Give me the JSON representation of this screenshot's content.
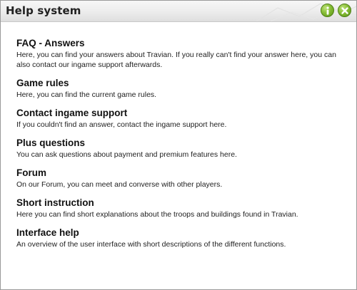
{
  "window": {
    "title": "Help system",
    "info_icon": "info-icon",
    "close_icon": "close-icon"
  },
  "entries": [
    {
      "title": "FAQ - Answers",
      "description": "Here, you can find your answers about Travian. If you really can't find your answer here, you can also contact our ingame support afterwards."
    },
    {
      "title": "Game rules",
      "description": "Here, you can find the current game rules."
    },
    {
      "title": "Contact ingame support",
      "description": "If you couldn't find an answer, contact the ingame support here."
    },
    {
      "title": "Plus questions",
      "description": "You can ask questions about payment and premium features here."
    },
    {
      "title": "Forum",
      "description": "On our Forum, you can meet and converse with other players."
    },
    {
      "title": "Short instruction",
      "description": "Here you can find short explanations about the troops and buildings found in Travian."
    },
    {
      "title": "Interface help",
      "description": "An overview of the user interface with short descriptions of the different functions."
    }
  ],
  "colors": {
    "accent": "#6fa82a",
    "title_text": "#222222"
  }
}
